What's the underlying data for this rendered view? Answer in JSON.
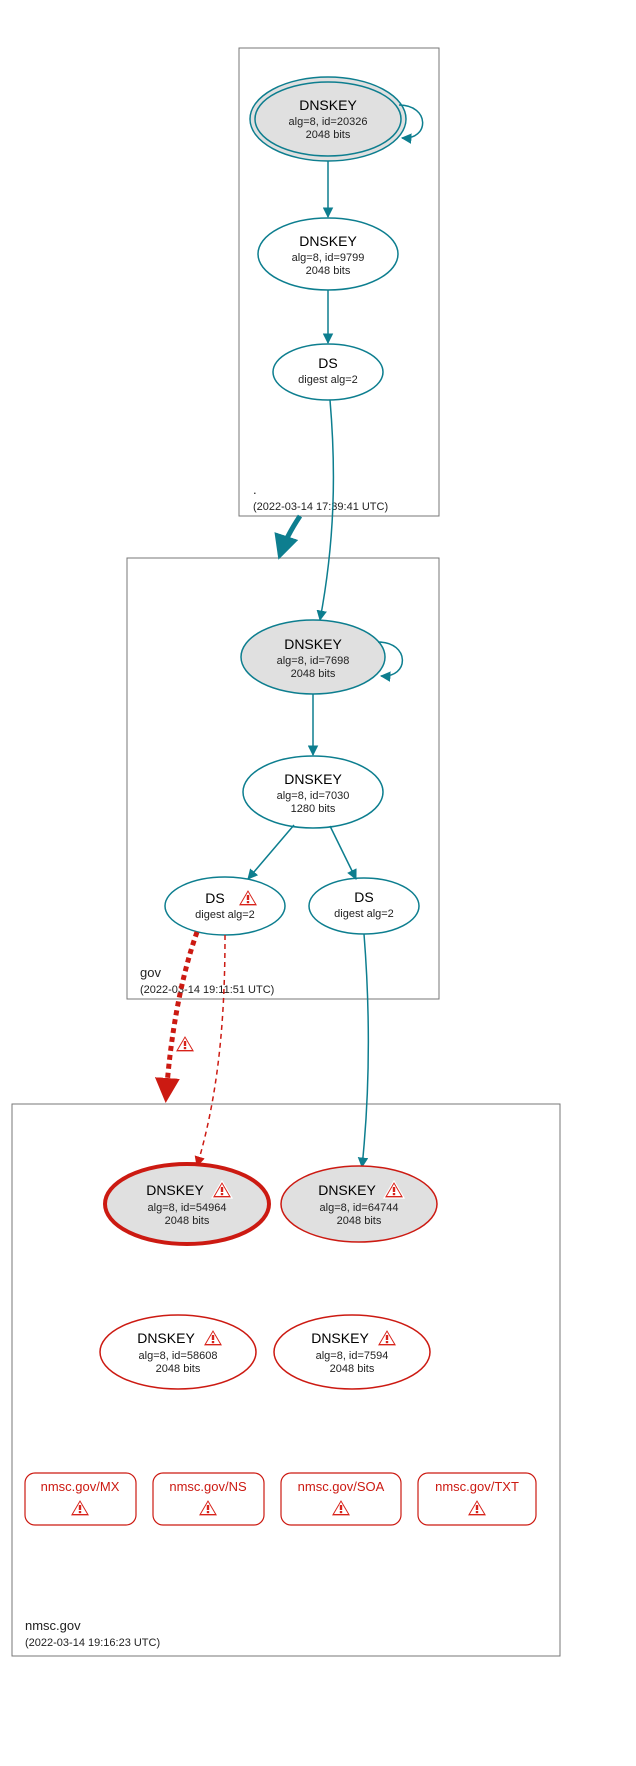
{
  "zones": {
    "root": {
      "label": ".",
      "timestamp": "(2022-03-14 17:39:41 UTC)"
    },
    "gov": {
      "label": "gov",
      "timestamp": "(2022-03-14 19:11:51 UTC)"
    },
    "nmsc": {
      "label": "nmsc.gov",
      "timestamp": "(2022-03-14 19:16:23 UTC)"
    }
  },
  "nodes": {
    "root_ksk": {
      "title": "DNSKEY",
      "l1": "alg=8, id=20326",
      "l2": "2048 bits"
    },
    "root_zsk": {
      "title": "DNSKEY",
      "l1": "alg=8, id=9799",
      "l2": "2048 bits"
    },
    "root_ds": {
      "title": "DS",
      "l1": "digest alg=2",
      "l2": ""
    },
    "gov_ksk": {
      "title": "DNSKEY",
      "l1": "alg=8, id=7698",
      "l2": "2048 bits"
    },
    "gov_zsk": {
      "title": "DNSKEY",
      "l1": "alg=8, id=7030",
      "l2": "1280 bits"
    },
    "gov_ds_warn": {
      "title": "DS",
      "l1": "digest alg=2",
      "l2": ""
    },
    "gov_ds": {
      "title": "DS",
      "l1": "digest alg=2",
      "l2": ""
    },
    "nmsc_k1": {
      "title": "DNSKEY",
      "l1": "alg=8, id=54964",
      "l2": "2048 bits"
    },
    "nmsc_k2": {
      "title": "DNSKEY",
      "l1": "alg=8, id=64744",
      "l2": "2048 bits"
    },
    "nmsc_k3": {
      "title": "DNSKEY",
      "l1": "alg=8, id=58608",
      "l2": "2048 bits"
    },
    "nmsc_k4": {
      "title": "DNSKEY",
      "l1": "alg=8, id=7594",
      "l2": "2048 bits"
    }
  },
  "rr": {
    "mx": "nmsc.gov/MX",
    "ns": "nmsc.gov/NS",
    "soa": "nmsc.gov/SOA",
    "txt": "nmsc.gov/TXT"
  }
}
